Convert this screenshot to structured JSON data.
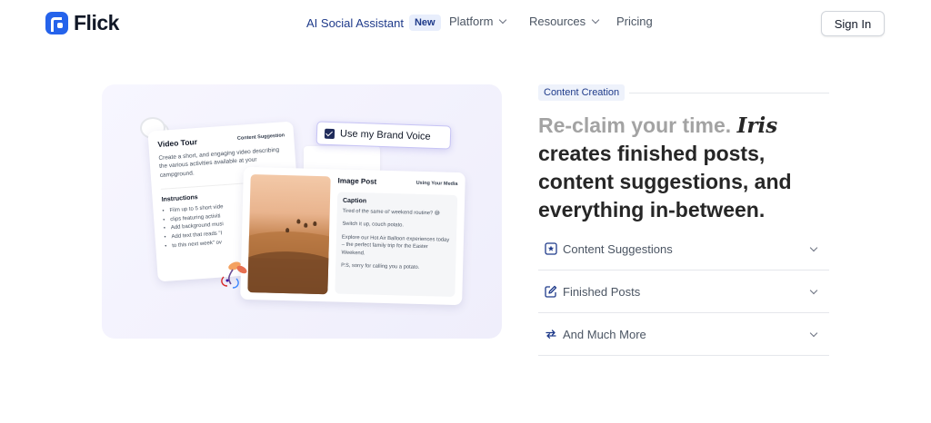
{
  "nav": {
    "logo_text": "Flick",
    "ai_label": "AI Social Assistant",
    "ai_badge": "New",
    "platform_label": "Platform",
    "resources_label": "Resources",
    "pricing_label": "Pricing",
    "signin_label": "Sign In"
  },
  "illustration": {
    "video_card": {
      "title": "Video Tour",
      "tag": "Content Suggestion",
      "body": "Create a short, and engaging video describing the various activities available at your campground.",
      "instructions_title": "Instructions",
      "instructions": [
        "Film up to 5 short vide",
        "clips featuring activiti",
        "Add background musi",
        "Add text that reads \"I",
        "to this next week\" ov"
      ]
    },
    "brand_voice_label": "Use my Brand Voice",
    "image_card": {
      "title": "Image Post",
      "tag": "Using Your Media",
      "caption_title": "Caption",
      "caption_lines": [
        "Tired of the same ol' weekend routine? 😅",
        "Switch it up, couch potato.",
        "Explore our Hot Air Balloon experiences today – the perfect family trip for the Easter Weekend.",
        "P.S, sorry for calling you a potato."
      ]
    }
  },
  "content": {
    "eyebrow": "Content Creation",
    "headline_muted": "Re-claim your time.",
    "headline_iris": "Iris",
    "headline_rest": "creates finished posts, content suggestions, and everything in-between.",
    "accordion": [
      {
        "label": "Content Suggestions",
        "icon": "star-box-icon"
      },
      {
        "label": "Finished Posts",
        "icon": "edit-icon"
      },
      {
        "label": "And Much More",
        "icon": "repeat-icon"
      }
    ]
  },
  "colors": {
    "brand_blue": "#2563eb",
    "navy": "#1e3a8a",
    "illustration_bg": "#f3f2fd"
  }
}
